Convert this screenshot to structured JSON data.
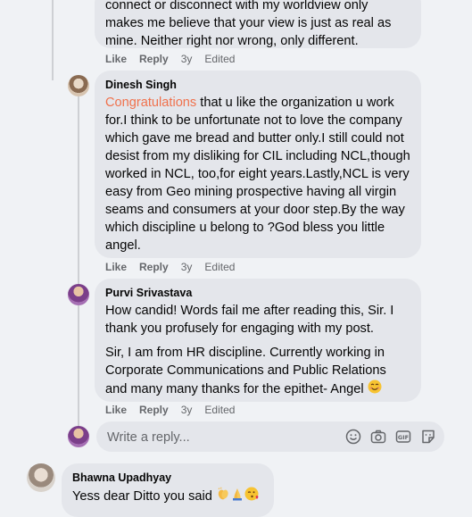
{
  "comments": [
    {
      "text_lines": [
        "connect or disconnect with my worldview only",
        "makes me believe that your view is just as real as",
        "mine. Neither right nor wrong, only different."
      ],
      "actions": {
        "like": "Like",
        "reply": "Reply",
        "age": "3y",
        "edited": "Edited"
      }
    },
    {
      "author": "Dinesh Singh",
      "highlight": "Congratulations",
      "text": " that u like the organization u work for.I think to be unfortunate not to love the company which gave me bread and butter only.I still could not desist from my disliking for CIL including NCL,though worked in NCL, too,for eight years.Lastly,NCL is very easy from Geo mining prospective having all virgin seams and consumers at your door step.By the way which discipline u belong to ?God bless you little angel.",
      "actions": {
        "like": "Like",
        "reply": "Reply",
        "age": "3y",
        "edited": "Edited"
      }
    },
    {
      "author": "Purvi Srivastava",
      "paragraphs": [
        "How candid! Words fail me after reading this, Sir. I thank you profusely for engaging with my post.",
        "Sir, I am from HR discipline. Currently working in Corporate Communications and Public Relations and many many thanks for the epithet- Angel"
      ],
      "actions": {
        "like": "Like",
        "reply": "Reply",
        "age": "3y",
        "edited": "Edited"
      }
    },
    {
      "author": "Bhawna Upadhyay",
      "text": "Yess dear Ditto you said"
    }
  ],
  "reply_box": {
    "placeholder": "Write a reply..."
  },
  "icons": [
    "smiley-icon",
    "camera-icon",
    "gif-icon",
    "sticker-icon",
    "clapping-hands-emoji",
    "folded-hands-emoji",
    "wink-kiss-emoji",
    "smiling-face-emoji"
  ]
}
